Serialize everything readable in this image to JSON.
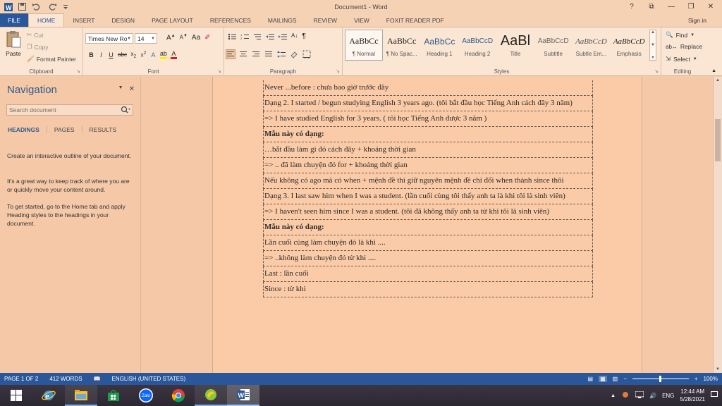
{
  "window": {
    "title": "Document1 - Word",
    "controls": [
      "?",
      "⧉",
      "—",
      "❐",
      "✕"
    ]
  },
  "ribbon_tabs": [
    "FILE",
    "HOME",
    "INSERT",
    "DESIGN",
    "PAGE LAYOUT",
    "REFERENCES",
    "MAILINGS",
    "REVIEW",
    "VIEW",
    "FOXIT READER PDF"
  ],
  "active_tab": "HOME",
  "signin": "Sign in",
  "clipboard": {
    "paste": "Paste",
    "cut": "Cut",
    "copy": "Copy",
    "format_painter": "Format Painter",
    "label": "Clipboard"
  },
  "font": {
    "name": "Times New Ro",
    "size": "14",
    "label": "Font"
  },
  "paragraph": {
    "label": "Paragraph"
  },
  "styles": {
    "label": "Styles",
    "items": [
      {
        "sample": "AaBbCc",
        "name": "¶ Normal"
      },
      {
        "sample": "AaBbCc",
        "name": "¶ No Spac..."
      },
      {
        "sample": "AaBbCc",
        "name": "Heading 1"
      },
      {
        "sample": "AaBbCcD",
        "name": "Heading 2"
      },
      {
        "sample": "AaBl",
        "name": "Title"
      },
      {
        "sample": "AaBbCcD",
        "name": "Subtitle"
      },
      {
        "sample": "AaBbCcD",
        "name": "Subtle Em..."
      },
      {
        "sample": "AaBbCcD",
        "name": "Emphasis"
      }
    ]
  },
  "editing": {
    "find": "Find",
    "replace": "Replace",
    "select": "Select",
    "label": "Editing"
  },
  "navigation": {
    "title": "Navigation",
    "search_placeholder": "Search document",
    "tabs": [
      "HEADINGS",
      "PAGES",
      "RESULTS"
    ],
    "help": [
      "Create an interactive outline of your document.",
      "It's a great way to keep track of where you are or quickly move your content around.",
      "To get started, go to the Home tab and apply Heading styles to the headings in your document."
    ]
  },
  "document": {
    "rows": [
      "Never ...before : chưa bao giờ trước đây",
      "Dạng 2. I started / begun studying English 3 years ago. (tôi bắt đầu học Tiếng Anh cách đây 3 năm)",
      "=> I have studied English for 3 years. ( tôi học Tiếng Anh được 3 năm )",
      "Mẫu này có dạng:",
      "…bắt đầu làm gì đó cách đây + khoảng thời gian",
      "=> .. đã làm chuyện đó for + khoảng thời gian",
      "Nếu không có ago mà có when + mệnh đề thì giữ nguyên mệnh đề chỉ đổi when thành since thôi",
      "Dạng 3. I last saw him when I was a student. (lần cuối cùng tôi thấy anh ta là khi tôi là sinh viên)",
      "=> I haven't seen him since I was a student. (tôi đã không thấy anh ta từ khi tôi là sinh viên)",
      "Mẫu này có dạng:",
      "Lần cuối cùng làm chuyện đó là khi ....",
      "=> ..không làm chuyện đó từ khi ....",
      "Last : lần cuối",
      "Since : từ khi"
    ]
  },
  "statusbar": {
    "page": "PAGE 1 OF 2",
    "words": "412 WORDS",
    "language": "ENGLISH (UNITED STATES)",
    "zoom": "100%"
  },
  "taskbar": {
    "apps": [
      "start",
      "internet-explorer",
      "file-explorer",
      "store",
      "zalo",
      "chrome",
      "unikey",
      "word"
    ],
    "zalo_label": "Zalo",
    "lang": "ENG",
    "time": "12:44 AM",
    "date": "5/28/2021"
  }
}
